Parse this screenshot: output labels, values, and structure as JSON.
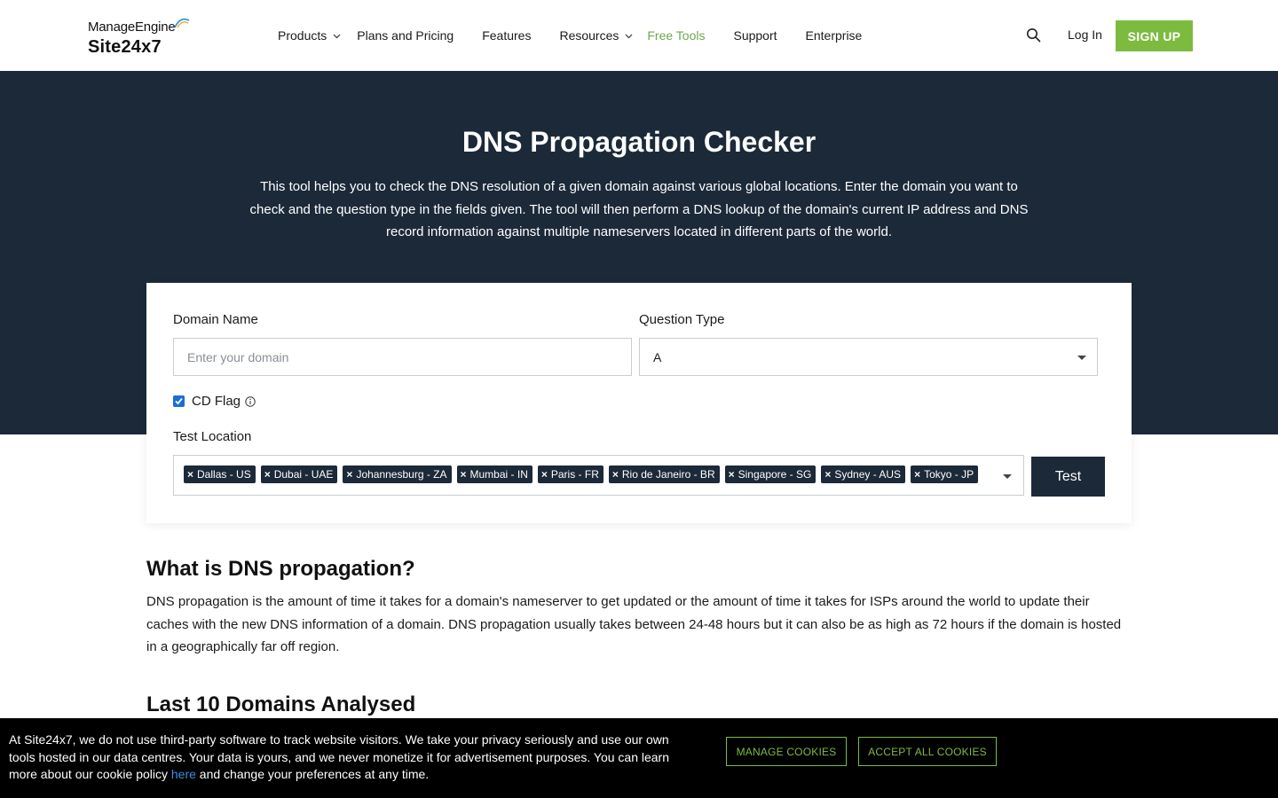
{
  "header": {
    "brand_top": "ManageEngine",
    "brand_bottom": "Site24x7",
    "nav": [
      {
        "label": "Products",
        "has_dropdown": true
      },
      {
        "label": "Plans and Pricing",
        "has_dropdown": false
      },
      {
        "label": "Features",
        "has_dropdown": false
      },
      {
        "label": "Resources",
        "has_dropdown": true
      },
      {
        "label": "Free Tools",
        "has_dropdown": false,
        "active": true
      },
      {
        "label": "Support",
        "has_dropdown": false
      },
      {
        "label": "Enterprise",
        "has_dropdown": false
      }
    ],
    "login_label": "Log In",
    "signup_label": "SIGN UP",
    "search_icon": "search-icon"
  },
  "hero": {
    "title": "DNS Propagation Checker",
    "description": "This tool helps you to check the DNS resolution of a given domain against various global locations. Enter the domain you want to check and the question type in the fields given. The tool will then perform a DNS lookup of the domain's current IP address and DNS record information against multiple nameservers located in different parts of the world."
  },
  "form": {
    "domain_label": "Domain Name",
    "domain_placeholder": "Enter your domain",
    "domain_value": "",
    "question_label": "Question Type",
    "question_value": "A",
    "cd_flag_label": "CD Flag",
    "cd_flag_checked": true,
    "location_label": "Test Location",
    "locations": [
      "Dallas - US",
      "Dubai - UAE",
      "Johannesburg - ZA",
      "Mumbai - IN",
      "Paris - FR",
      "Rio de Janeiro - BR",
      "Singapore - SG",
      "Sydney - AUS",
      "Tokyo - JP"
    ],
    "test_label": "Test"
  },
  "content": {
    "what_heading": "What is DNS propagation?",
    "what_text": "DNS propagation is the amount of time it takes for a domain's nameserver to get updated or the amount of time it takes for ISPs around the world to update their caches with the new DNS information of a domain. DNS propagation usually takes between 24-48 hours but it can also be as high as 72 hours if the domain is hosted in a geographically far off region.",
    "last_heading": "Last 10 Domains Analysed"
  },
  "cookie": {
    "text_before": "At Site24x7, we do not use third-party software to track website visitors. We take your privacy seriously and use our own tools hosted in our data centres. Your data is yours, and we never monetize it for advertisement purposes. You can learn more about our cookie policy ",
    "link_label": "here",
    "text_after": " and change your preferences at any time.",
    "manage_label": "MANAGE COOKIES",
    "accept_label": "ACCEPT ALL COOKIES"
  },
  "colors": {
    "brand_green": "#7cbb3f",
    "navy": "#1c2939",
    "link_blue": "#3d8fe0"
  }
}
